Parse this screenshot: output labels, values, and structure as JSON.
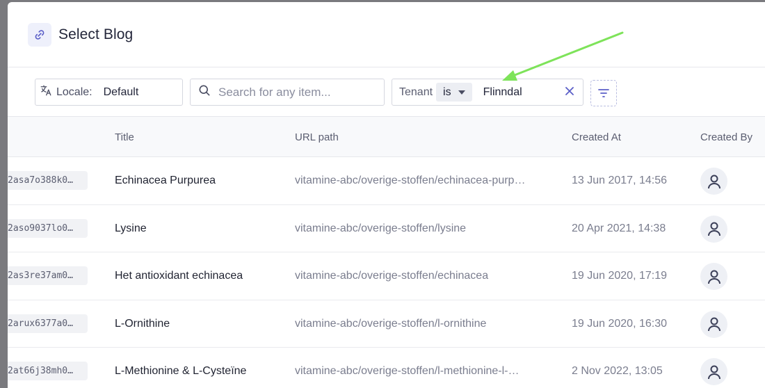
{
  "dialog": {
    "title": "Select Blog",
    "title_icon": "link-icon"
  },
  "toolbar": {
    "locale": {
      "label": "Locale:",
      "value": "Default",
      "icon": "translate-icon"
    },
    "search": {
      "placeholder": "Search for any item...",
      "icon": "search-icon"
    },
    "filter": {
      "field": "Tenant",
      "operator": "is",
      "value": "Flinndal",
      "clear_icon": "close-icon"
    },
    "filter_button_icon": "filter-icon"
  },
  "table": {
    "columns": [
      "Title",
      "URL path",
      "Created At",
      "Created By"
    ],
    "rows": [
      {
        "id": "2asa7o388k0…",
        "title": "Echinacea Purpurea",
        "url": "vitamine-abc/overige-stoffen/echinacea-purp…",
        "created_at": "13 Jun 2017, 14:56"
      },
      {
        "id": "2aso9037lo0…",
        "title": "Lysine",
        "url": "vitamine-abc/overige-stoffen/lysine",
        "created_at": "20 Apr 2021, 14:38"
      },
      {
        "id": "2as3re37am0…",
        "title": "Het antioxidant echinacea",
        "url": "vitamine-abc/overige-stoffen/echinacea",
        "created_at": "19 Jun 2020, 17:19"
      },
      {
        "id": "2arux6377a0…",
        "title": "L-Ornithine",
        "url": "vitamine-abc/overige-stoffen/l-ornithine",
        "created_at": "19 Jun 2020, 16:30"
      },
      {
        "id": "2at66j38mh0…",
        "title": "L-Methionine & L-Cysteïne",
        "url": "vitamine-abc/overige-stoffen/l-methionine-l-…",
        "created_at": "2 Nov 2022, 13:05"
      }
    ]
  },
  "annotation": {
    "color": "#7ee35a"
  },
  "colors": {
    "accent": "#5b5fc7",
    "header_bg": "#f8f9fb"
  }
}
